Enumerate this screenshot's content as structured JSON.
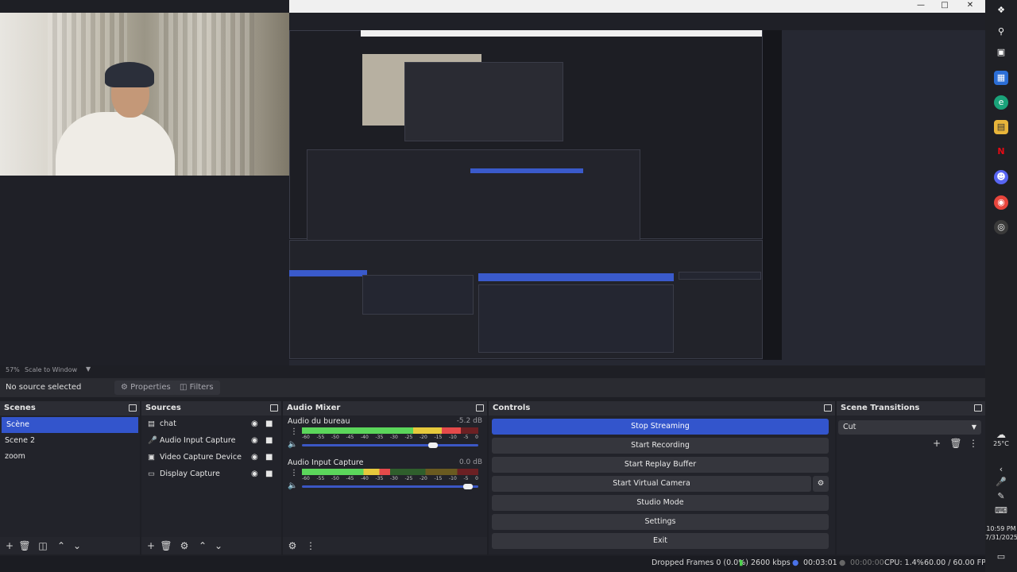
{
  "preview": {
    "zoom_percent": "57%",
    "scale_mode": "Scale to Window"
  },
  "sourcebar": {
    "selection": "No source selected",
    "properties": "Properties",
    "filters": "Filters"
  },
  "scenes": {
    "title": "Scenes",
    "items": [
      {
        "label": "Scène"
      },
      {
        "label": "Scene 2"
      },
      {
        "label": "zoom"
      }
    ]
  },
  "sources": {
    "title": "Sources",
    "items": [
      {
        "label": "chat",
        "icon": "window-capture-icon"
      },
      {
        "label": "Audio Input Capture",
        "icon": "microphone-icon"
      },
      {
        "label": "Video Capture Device",
        "icon": "camera-icon"
      },
      {
        "label": "Display Capture",
        "icon": "monitor-icon"
      }
    ]
  },
  "mixer": {
    "title": "Audio Mixer",
    "ticks": [
      "-60",
      "-55",
      "-50",
      "-45",
      "-40",
      "-35",
      "-30",
      "-25",
      "-20",
      "-15",
      "-10",
      "-5",
      "0"
    ],
    "channels": [
      {
        "name": "Audio du bureau",
        "db": "-5.2 dB",
        "level": 0.9,
        "volume": 0.77
      },
      {
        "name": "Audio Input Capture",
        "db": "0.0 dB",
        "level": 0.5,
        "volume": 0.97
      }
    ]
  },
  "controls": {
    "title": "Controls",
    "stop_streaming": "Stop Streaming",
    "start_recording": "Start Recording",
    "start_replay": "Start Replay Buffer",
    "start_virtual_camera": "Start Virtual Camera",
    "studio_mode": "Studio Mode",
    "settings": "Settings",
    "exit": "Exit"
  },
  "transitions": {
    "title": "Scene Transitions",
    "selected": "Cut"
  },
  "status": {
    "dropped_frames": "Dropped Frames 0 (0.0%)",
    "bitrate": "2600 kbps",
    "stream_time": "00:03:01",
    "record_time": "00:00:00",
    "cpu": "CPU: 1.4%",
    "fps": "60.00 / 60.00 FPS"
  },
  "taskbar": {
    "temperature": "25°C",
    "time": "10:59 PM",
    "date": "7/31/2025"
  },
  "colors": {
    "accent": "#3355cc",
    "background": "#1e1f25"
  }
}
